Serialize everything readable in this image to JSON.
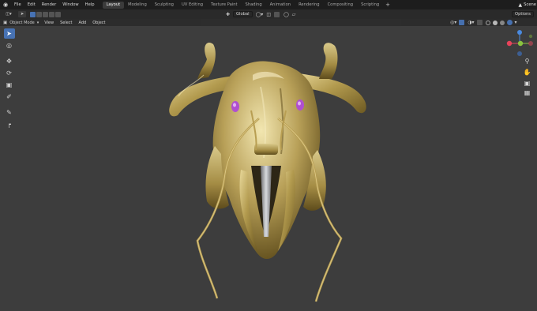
{
  "topbar": {
    "menus": [
      "File",
      "Edit",
      "Render",
      "Window",
      "Help"
    ],
    "workspaces": [
      "Layout",
      "Modeling",
      "Sculpting",
      "UV Editing",
      "Texture Paint",
      "Shading",
      "Animation",
      "Rendering",
      "Compositing",
      "Scripting"
    ],
    "active_workspace": "Layout",
    "add_tab": "+",
    "scene_label": "Scene"
  },
  "header": {
    "orientation": "Global",
    "options": "Options"
  },
  "header2": {
    "mode": "Object Mode",
    "menus": [
      "View",
      "Select",
      "Add",
      "Object"
    ]
  },
  "gizmo": {
    "x": "X",
    "y": "Y",
    "z": "Z"
  },
  "colors": {
    "accent": "#4772b3",
    "viewport": "#3d3d3d",
    "gold": "#b8a35a",
    "gem": "#b04fd0",
    "axis_x": "#e8435a",
    "axis_y": "#8ac33f",
    "axis_z": "#4a8ae0"
  },
  "icons": [
    "select-icon",
    "cursor-icon",
    "move-icon",
    "rotate-icon",
    "scale-icon",
    "transform-icon",
    "annotate-icon",
    "measure-icon",
    "zoom-icon",
    "pan-icon",
    "camera-icon",
    "grid-icon"
  ]
}
